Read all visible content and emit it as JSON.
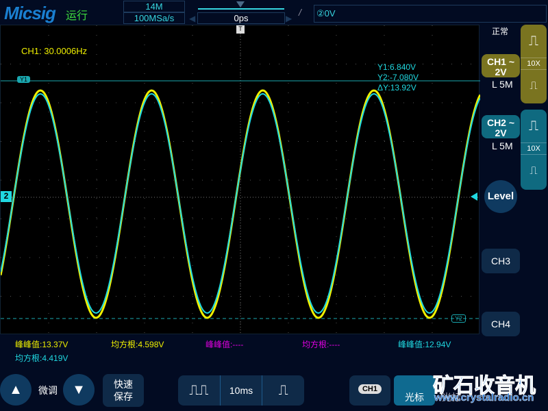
{
  "header": {
    "brand": "Micsig",
    "status": "运行",
    "memory_depth": "14M",
    "sample_rate": "100MSa/s",
    "time_offset": "0ps",
    "trigger_edge_icon": "rising-edge",
    "trigger_info": "②0V"
  },
  "plot": {
    "frequency": "CH1: 30.0006Hz",
    "cursor_readout": {
      "y1": "Y1:6.840V",
      "y2": "Y2:-7.080V",
      "dy": "ΔY:13.92V"
    },
    "cursor_labels": {
      "y1": "Y1",
      "y2": "Y2"
    },
    "ch2_marker": "2",
    "colors": {
      "ch1": "#f0f000",
      "ch2": "#20d8e0",
      "cursor": "#1aa8b0"
    }
  },
  "measurements": [
    {
      "label": "峰峰值:13.37V",
      "color": "#f0f000"
    },
    {
      "label": "均方根:4.598V",
      "color": "#f0f000"
    },
    {
      "label": "峰峰值:----",
      "color": "#e000e0"
    },
    {
      "label": "均方根:----",
      "color": "#e000e0"
    },
    {
      "label": "峰峰值:12.94V",
      "color": "#20d8e0"
    },
    {
      "label": "均方根:4.419V",
      "color": "#20d8e0"
    }
  ],
  "sidebar": {
    "acq_mode": "正常",
    "ch1": {
      "name": "CH1 ~",
      "scale": "2V",
      "coupling": "L 5M",
      "probe": "10X"
    },
    "ch2": {
      "name": "CH2 ~",
      "scale": "2V",
      "coupling": "L 5M",
      "probe": "10X"
    },
    "level": "Level",
    "ch3": "CH3",
    "ch4": "CH4"
  },
  "footer": {
    "fine_adjust": "微调",
    "quick_save_1": "快速",
    "quick_save_2": "保存",
    "timebase": "10ms",
    "cursor_source": "CH1",
    "cursor_label": "光标",
    "cursor_label2": "光标",
    "watermark": "矿石收音机",
    "watermark_url": "www.crystalradio.cn"
  }
}
